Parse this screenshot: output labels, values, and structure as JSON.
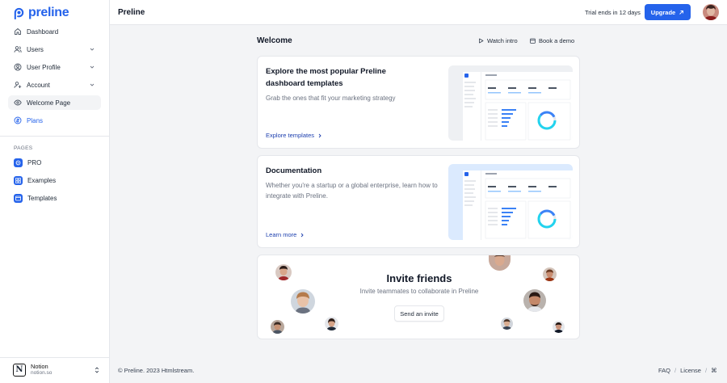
{
  "brand": {
    "name": "preline",
    "color": "#2563eb"
  },
  "sidebar": {
    "items": [
      {
        "label": "Dashboard",
        "icon": "home-icon"
      },
      {
        "label": "Users",
        "icon": "users-icon",
        "expandable": true
      },
      {
        "label": "User Profile",
        "icon": "user-profile-icon",
        "expandable": true
      },
      {
        "label": "Account",
        "icon": "account-icon",
        "expandable": true
      },
      {
        "label": "Welcome Page",
        "icon": "eye-icon",
        "active": true
      },
      {
        "label": "Plans",
        "icon": "plans-icon",
        "highlight": true
      }
    ],
    "pages_heading": "PAGES",
    "pages": [
      {
        "label": "PRO",
        "icon": "pro-icon"
      },
      {
        "label": "Examples",
        "icon": "examples-icon"
      },
      {
        "label": "Templates",
        "icon": "templates-icon"
      }
    ],
    "workspace": {
      "name": "Notion",
      "domain": "notion.so",
      "logo_letter": "N"
    }
  },
  "header": {
    "title": "Preline",
    "trial_text": "Trial ends in 12 days",
    "upgrade_label": "Upgrade"
  },
  "main": {
    "title": "Welcome",
    "watch_intro": "Watch intro",
    "book_demo": "Book a demo",
    "cards": [
      {
        "title": "Explore the most popular Preline dashboard templates",
        "description": "Grab the ones that fit your marketing strategy",
        "link": "Explore templates"
      },
      {
        "title": "Documentation",
        "description": "Whether you're a startup or a global enterprise, learn how to integrate with Preline.",
        "link": "Learn more"
      }
    ],
    "invite": {
      "title": "Invite friends",
      "subtitle": "Invite teammates to collaborate in Preline",
      "button": "Send an invite"
    }
  },
  "footer": {
    "copyright": "© Preline. 2023 Htmlstream.",
    "links": [
      "FAQ",
      "License"
    ],
    "shortcut_symbol": "⌘"
  }
}
